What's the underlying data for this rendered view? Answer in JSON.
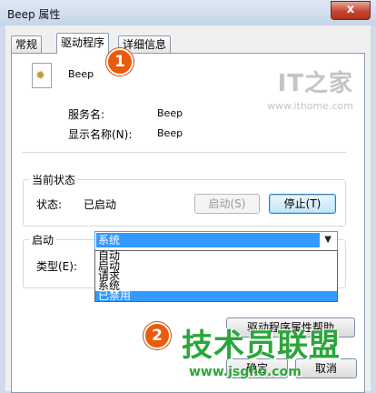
{
  "window": {
    "title": "Beep 属性",
    "close_symbol": "x"
  },
  "tabs": [
    {
      "label": "常规",
      "active": false
    },
    {
      "label": "驱动程序",
      "active": true
    },
    {
      "label": "详细信息",
      "active": false
    }
  ],
  "watermark": {
    "logo": "IT之家",
    "url": "www.ithome.com"
  },
  "service": {
    "name": "Beep",
    "fields": [
      {
        "label": "服务名:",
        "value": "Beep"
      },
      {
        "label": "显示名称(N):",
        "value": "Beep"
      }
    ]
  },
  "status_group": {
    "title": "当前状态",
    "status_label": "状态:",
    "status_value": "已启动",
    "start_button": "启动(S)",
    "stop_button": "停止(T)"
  },
  "startup_group": {
    "title": "启动",
    "type_label": "类型(E):",
    "selected": "系统",
    "options": [
      "自动",
      "启动",
      "请求",
      "系统",
      "已禁用"
    ],
    "highlighted_option": "已禁用"
  },
  "footer": {
    "partial_button": "驱动程序属性帮助",
    "ok_button": "确定",
    "cancel_button": "取消"
  },
  "annotations": [
    {
      "label": "1"
    },
    {
      "label": "2"
    }
  ],
  "site_banner": {
    "title": "技术员联盟",
    "url": "www.jsgho.com"
  }
}
